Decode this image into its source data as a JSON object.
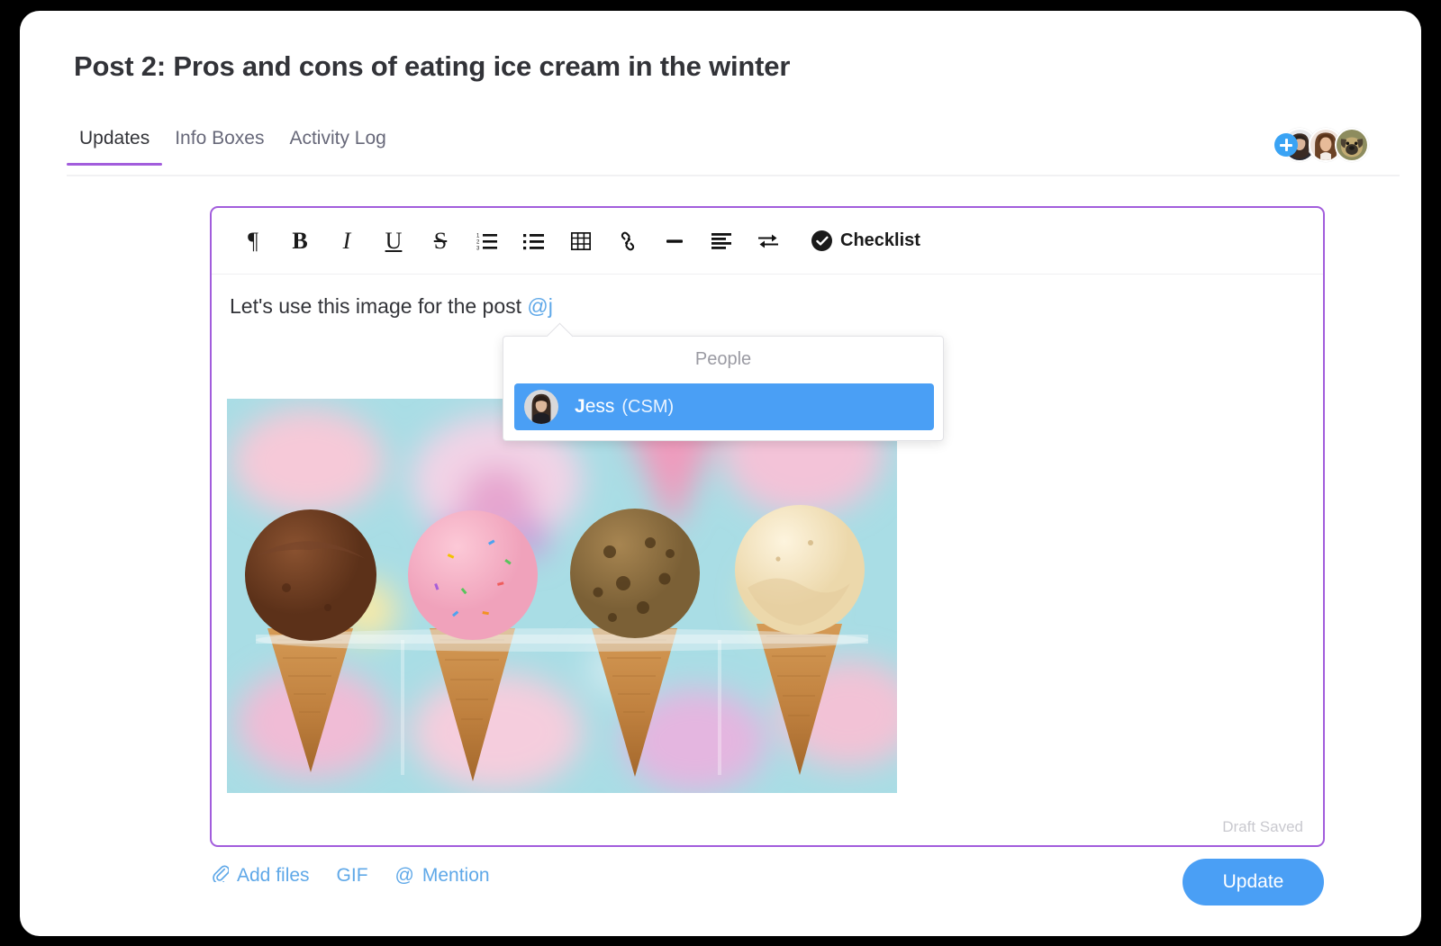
{
  "page_title": "Post 2: Pros and cons of eating ice cream in the winter",
  "tabs": [
    {
      "label": "Updates",
      "active": true
    },
    {
      "label": "Info Boxes",
      "active": false
    },
    {
      "label": "Activity Log",
      "active": false
    }
  ],
  "avatars": {
    "add_label": "+",
    "members": [
      {
        "name": "person-dark-hair"
      },
      {
        "name": "person-brown-hair"
      },
      {
        "name": "pug-dog"
      }
    ]
  },
  "editor": {
    "toolbar": {
      "paragraph": "¶",
      "bold": "B",
      "italic": "I",
      "underline": "U",
      "strikethrough": "S",
      "ordered_list": "ordered-list-icon",
      "bullet_list": "bullet-list-icon",
      "table": "table-icon",
      "link": "link-icon",
      "horizontal_rule": "horizontal-rule-icon",
      "align": "align-left-icon",
      "swap": "swap-arrows-icon",
      "checklist_label": "Checklist"
    },
    "content": {
      "text": "Let's use this image for the post ",
      "mention": "@j"
    },
    "draft_status": "Draft Saved",
    "border_color": "#a25ddc"
  },
  "mention_popup": {
    "header": "People",
    "person": {
      "name_bold": "J",
      "name_rest": "ess",
      "role": "(CSM)"
    },
    "highlight_color": "#4a9ff5"
  },
  "footer": {
    "add_files": "Add files",
    "gif": "GIF",
    "mention": "Mention",
    "mention_symbol": "@",
    "update_button": "Update",
    "link_color": "#5fa8e8",
    "button_color": "#4a9ff5"
  }
}
